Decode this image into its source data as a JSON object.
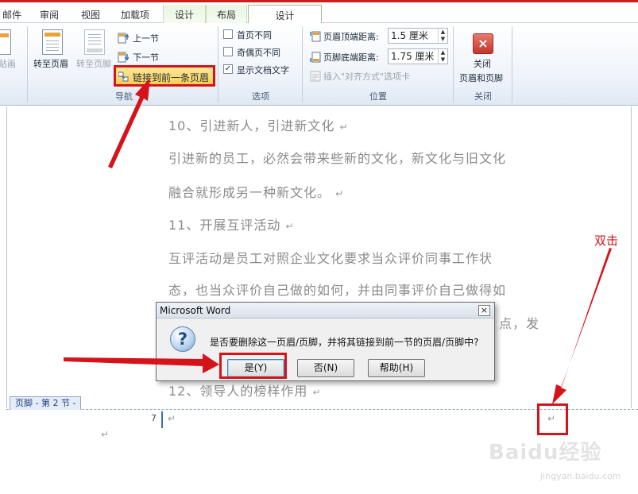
{
  "tabs": [
    {
      "label": "邮件"
    },
    {
      "label": "审阅"
    },
    {
      "label": "视图"
    },
    {
      "label": "加载项"
    },
    {
      "label": "设计"
    },
    {
      "label": "布局"
    },
    {
      "label": "设计"
    }
  ],
  "ribbon": {
    "clip_label": "贴画",
    "nav": {
      "goto_header": "转至页眉",
      "goto_footer": "转至页脚",
      "prev_section": "上一节",
      "next_section": "下一节",
      "link_previous": "链接到前一条页眉",
      "group_label": "导航"
    },
    "options": {
      "diff_first_page": "首页不同",
      "diff_odd_even": "奇偶页不同",
      "show_doc_text": "显示文档文字",
      "show_doc_text_checked": "✓",
      "group_label": "选项"
    },
    "position": {
      "header_top_label": "页眉顶端距离:",
      "header_top_value": "1.5 厘米",
      "footer_bottom_label": "页脚底端距离:",
      "footer_bottom_value": "1.75 厘米",
      "insert_align_tab": "插入\"对齐方式\"选项卡",
      "group_label": "位置"
    },
    "close": {
      "label_line1": "关闭",
      "label_line2": "页眉和页脚",
      "group_label": "关闭"
    }
  },
  "document": {
    "paragraphs": [
      "10、引进新人，引进新文化",
      "引进新的员工，必然会带来些新的文化，新文化与旧文化",
      "融合就形成另一种新文化。",
      "11、开展互评活动",
      "互评活动是员工对照企业文化要求当众评价同事工作状",
      "态，也当众评价自己做的如何，并由同事评价自己做得如",
      "点，发",
      "12、领导人的榜样作用"
    ],
    "pilcrow": "↵",
    "footer_tag": "页脚 - 第 2 节 -",
    "footer_page_number": "7"
  },
  "dialog": {
    "title": "Microsoft Word",
    "close_glyph": "×",
    "question_glyph": "?",
    "message": "是否要删除这一页眉/页脚，并将其链接到前一节的页眉/页脚中?",
    "buttons": {
      "yes": "是(Y)",
      "no": "否(N)",
      "help": "帮助(H)"
    }
  },
  "annotation": {
    "double_click": "双击"
  },
  "watermark": {
    "main": "Baidu经验",
    "sub": "jingyan.baidu.com"
  }
}
